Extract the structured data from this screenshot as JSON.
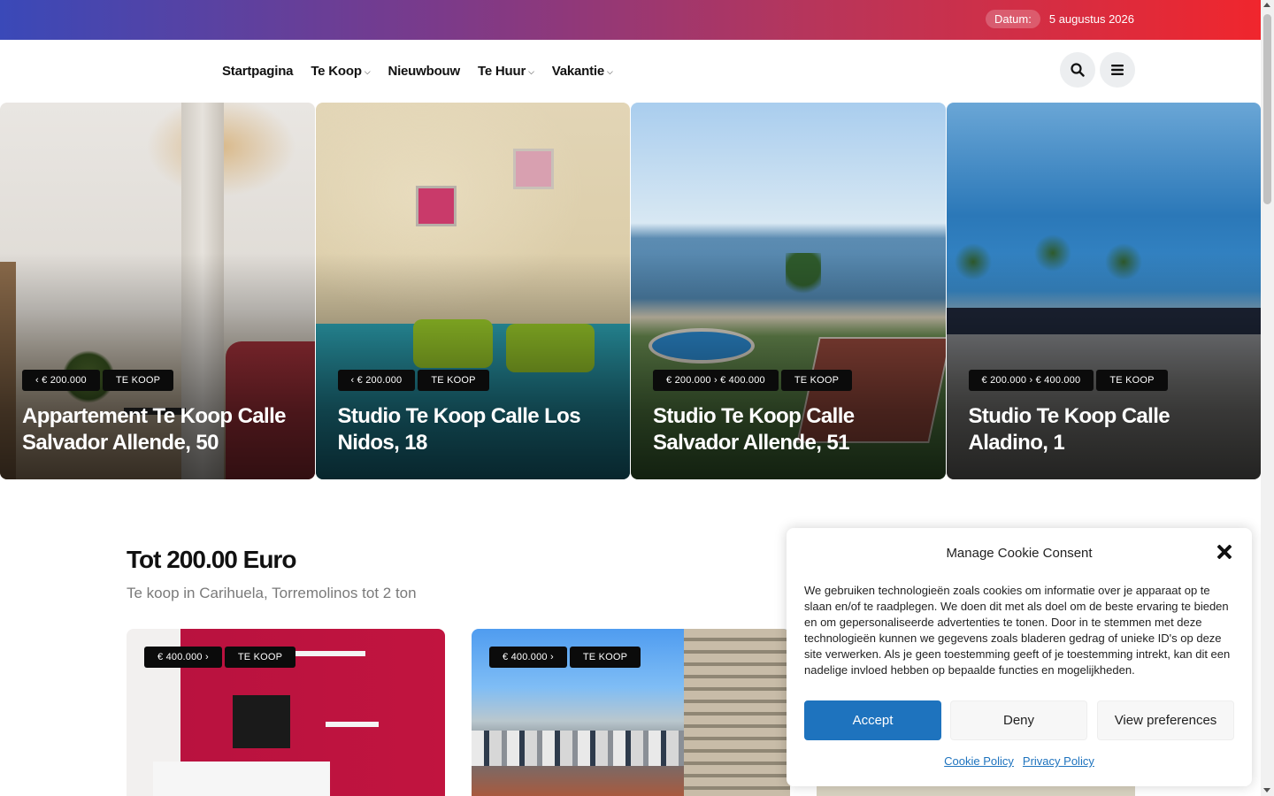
{
  "topbar": {
    "date_label": "Datum:",
    "date_value": "5 augustus 2026"
  },
  "nav": {
    "items": [
      {
        "label": "Startpagina",
        "dropdown": false
      },
      {
        "label": "Te Koop",
        "dropdown": true
      },
      {
        "label": "Nieuwbouw",
        "dropdown": false
      },
      {
        "label": "Te Huur",
        "dropdown": true
      },
      {
        "label": "Vakantie",
        "dropdown": true
      }
    ],
    "caret": "⌵",
    "search_icon": "search-icon",
    "menu_icon": "hamburger-menu-icon"
  },
  "hero": [
    {
      "price": "‹ € 200.000",
      "type": "TE KOOP",
      "title": "Appartement Te Koop Calle Salvador Allende, 50"
    },
    {
      "price": "‹ € 200.000",
      "type": "TE KOOP",
      "title": "Studio Te Koop Calle Los Nidos, 18"
    },
    {
      "price": "€ 200.000 › € 400.000",
      "type": "TE KOOP",
      "title": "Studio Te Koop Calle Salvador Allende, 51"
    },
    {
      "price": "€ 200.000 › € 400.000",
      "type": "TE KOOP",
      "title": "Studio Te Koop Calle Aladino, 1"
    }
  ],
  "section": {
    "title": "Tot 200.00 Euro",
    "subtitle": "Te koop in Carihuela, Torremolinos tot 2 ton",
    "cards": [
      {
        "price": "€ 400.000 ›",
        "type": "TE KOOP"
      },
      {
        "price": "€ 400.000 ›",
        "type": "TE KOOP"
      }
    ]
  },
  "cookie": {
    "title": "Manage Cookie Consent",
    "text": "We gebruiken technologieën zoals cookies om informatie over je apparaat op te slaan en/of te raadplegen. We doen dit met als doel om de beste ervaring te bieden en om gepersonaliseerde advertenties te tonen. Door in te stemmen met deze technologieën kunnen we gegevens zoals bladeren gedrag of unieke ID's op deze site verwerken. Als je geen toestemming geeft of je toestemming intrekt, kan dit een nadelige invloed hebben op bepaalde functies en mogelijkheden.",
    "accept": "Accept",
    "deny": "Deny",
    "preferences": "View preferences",
    "links": [
      "Cookie Policy",
      "Privacy Policy"
    ],
    "accent_color": "#1e73be"
  },
  "colors": {
    "gradient_start": "#3a49b8",
    "gradient_end": "#f0262d"
  }
}
